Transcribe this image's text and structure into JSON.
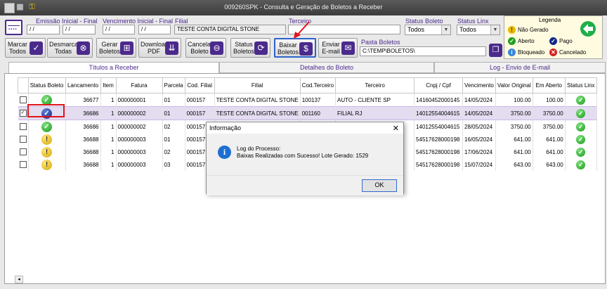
{
  "window": {
    "title": "009260SPK - Consulta e Geração de Boletos a Receber"
  },
  "filters": {
    "emissao": {
      "label": "Emissão Inicial - Final",
      "start": "/ /",
      "end": "/ /"
    },
    "vencimento": {
      "label": "Vencimento Inicial - Final",
      "start": "/ /",
      "end": "/ /"
    },
    "filial": {
      "label": "Filial",
      "value": "TESTE CONTA DIGITAL STONE"
    },
    "terceiro": {
      "label": "Terceiro",
      "value": ""
    },
    "status_boleto": {
      "label": "Status Boleto",
      "value": "Todos"
    },
    "status_linx": {
      "label": "Status Linx",
      "value": "Todos"
    },
    "pasta": {
      "label": "Pasta Boletos",
      "value": "C:\\TEMP\\BOLETOS\\"
    }
  },
  "toolbar": {
    "marcar": "Marcar Todos",
    "desmarcar": "Desmarcar Todas",
    "gerar": "Gerar Boletos",
    "download": "Download PDF",
    "cancelar": "Cancelar Boleto",
    "status": "Status Boletos",
    "baixar": "Baixar Boletos",
    "enviar": "Enviar E-mail"
  },
  "legend": {
    "title": "Legenda",
    "nao_gerado": "Não Gerado",
    "aberto": "Aberto",
    "pago": "Pago",
    "bloqueado": "Bloqueado",
    "cancelado": "Cancelado"
  },
  "tabs": [
    "Títulos a Receber",
    "Detalhes do Boleto",
    "Log - Envio de E-mail"
  ],
  "grid": {
    "columns": [
      "Status Boleto",
      "Lancamento",
      "Item",
      "Fatura",
      "Parcela",
      "Cod. Filial",
      "Filial",
      "Cod.Terceiro",
      "Terceiro",
      "Cnpj / Cpf",
      "Vencimento",
      "Valor Original",
      "Em Aberto",
      "Status Linx"
    ],
    "rows": [
      {
        "checked": false,
        "status": "aberto",
        "lancamento": "36677",
        "item": "1",
        "fatura": "000000001",
        "parcela": "01",
        "cod_filial": "000157",
        "filial": "TESTE CONTA DIGITAL STONE",
        "cod_terceiro": "100137",
        "terceiro": "AUTO - CLIENTE SP",
        "cnpj": "14160452000145",
        "vencimento": "14/05/2024",
        "valor_original": "100.00",
        "em_aberto": "100.00"
      },
      {
        "checked": true,
        "status": "pago",
        "lancamento": "36686",
        "item": "1",
        "fatura": "000000002",
        "parcela": "01",
        "cod_filial": "000157",
        "filial": "TESTE CONTA DIGITAL STONE",
        "cod_terceiro": "001160",
        "terceiro": "FILIAL RJ",
        "cnpj": "14012554004615",
        "vencimento": "14/05/2024",
        "valor_original": "3750.00",
        "em_aberto": "3750.00"
      },
      {
        "checked": false,
        "status": "aberto",
        "lancamento": "36686",
        "item": "1",
        "fatura": "000000002",
        "parcela": "02",
        "cod_filial": "000157",
        "filial": "",
        "cod_terceiro": "",
        "terceiro": "",
        "cnpj": "14012554004615",
        "vencimento": "28/05/2024",
        "valor_original": "3750.00",
        "em_aberto": "3750.00"
      },
      {
        "checked": false,
        "status": "naogerado",
        "lancamento": "36688",
        "item": "1",
        "fatura": "000000003",
        "parcela": "01",
        "cod_filial": "000157",
        "filial": "",
        "cod_terceiro": "",
        "terceiro": "",
        "cnpj": "54517628000198",
        "vencimento": "16/05/2024",
        "valor_original": "641.00",
        "em_aberto": "641.00"
      },
      {
        "checked": false,
        "status": "naogerado",
        "lancamento": "36688",
        "item": "1",
        "fatura": "000000003",
        "parcela": "02",
        "cod_filial": "000157",
        "filial": "",
        "cod_terceiro": "",
        "terceiro": "",
        "cnpj": "54517628000198",
        "vencimento": "17/06/2024",
        "valor_original": "641.00",
        "em_aberto": "641.00"
      },
      {
        "checked": false,
        "status": "naogerado",
        "lancamento": "36688",
        "item": "1",
        "fatura": "000000003",
        "parcela": "03",
        "cod_filial": "000157",
        "filial": "",
        "cod_terceiro": "",
        "terceiro": "",
        "cnpj": "54517628000198",
        "vencimento": "15/07/2024",
        "valor_original": "643.00",
        "em_aberto": "643.00"
      }
    ]
  },
  "dialog": {
    "title": "Informação",
    "line1": "Log do Processo:",
    "line2": "Baixas Realizadas com Sucesso! Lote Gerado: 1529",
    "ok": "OK",
    "close": "✕"
  }
}
